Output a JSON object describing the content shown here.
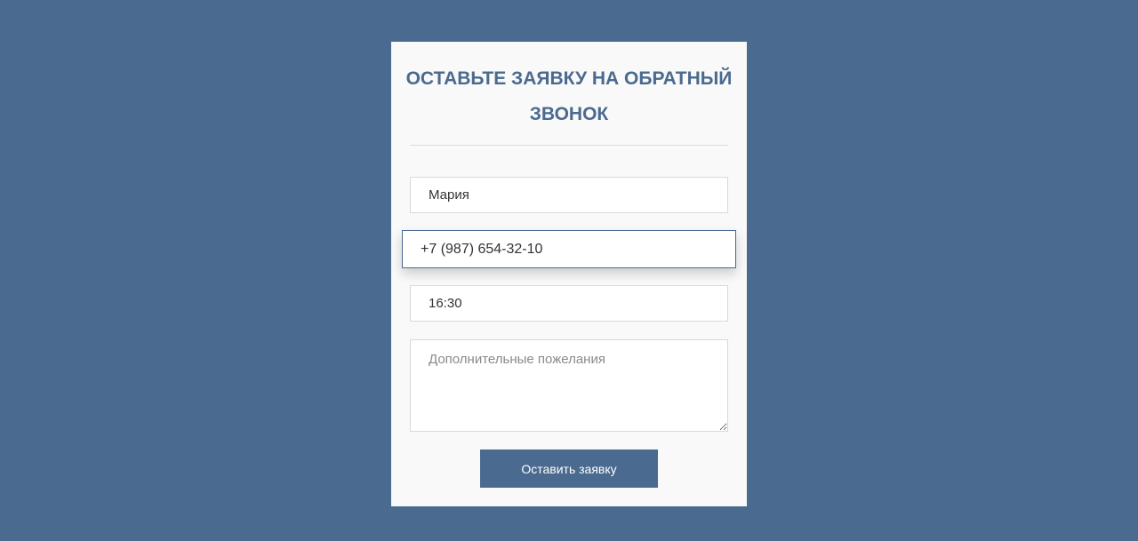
{
  "form": {
    "title": "ОСТАВЬТЕ ЗАЯВКУ НА ОБРАТНЫЙ ЗВОНОК",
    "name_value": "Мария",
    "phone_value": "+7 (987) 654-32-10",
    "time_value": "16:30",
    "wishes_placeholder": "Дополнительные пожелания",
    "submit_label": "Оставить заявку"
  },
  "colors": {
    "background": "#4a6a8f",
    "card": "#f9f9f9",
    "accent": "#4a6a8f"
  }
}
